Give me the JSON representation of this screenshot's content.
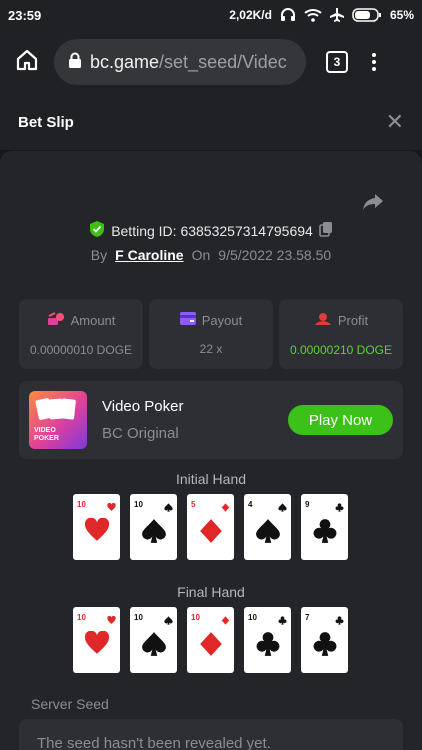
{
  "status": {
    "time": "23:59",
    "speed": "2,02K/d",
    "battery": "65%"
  },
  "browser": {
    "url_host": "bc.game",
    "url_path": "/set_seed/Videc",
    "tab_count": "3"
  },
  "header": {
    "title": "Bet Slip"
  },
  "bet": {
    "id_label": "Betting ID: 63853257314795694",
    "by_label": "By",
    "user": "F Caroline",
    "on_label": "On",
    "date": "9/5/2022 23.58.50"
  },
  "stats": {
    "amount_label": "Amount",
    "amount_value": "0.00000010 DOGE",
    "payout_label": "Payout",
    "payout_value": "22 x",
    "profit_label": "Profit",
    "profit_value": "0.00000210 DOGE"
  },
  "game": {
    "name": "Video Poker",
    "subtitle": "BC Original",
    "play_label": "Play Now",
    "thumb_text_1": "VIDEO",
    "thumb_text_2": "POKER"
  },
  "initial_hand": {
    "label": "Initial Hand",
    "cards": [
      {
        "rank": "10",
        "suit": "hearts"
      },
      {
        "rank": "10",
        "suit": "spades"
      },
      {
        "rank": "5",
        "suit": "diamonds"
      },
      {
        "rank": "4",
        "suit": "spades"
      },
      {
        "rank": "9",
        "suit": "clubs"
      }
    ]
  },
  "final_hand": {
    "label": "Final Hand",
    "cards": [
      {
        "rank": "10",
        "suit": "hearts"
      },
      {
        "rank": "10",
        "suit": "spades"
      },
      {
        "rank": "10",
        "suit": "diamonds"
      },
      {
        "rank": "10",
        "suit": "clubs"
      },
      {
        "rank": "7",
        "suit": "clubs"
      }
    ]
  },
  "seed": {
    "label": "Server Seed",
    "value": "The seed hasn't been revealed yet."
  },
  "colors": {
    "accent_green": "#3bc117",
    "profit_green": "#5fd22b",
    "panel": "#232529",
    "card_bg": "#2d2f34"
  }
}
